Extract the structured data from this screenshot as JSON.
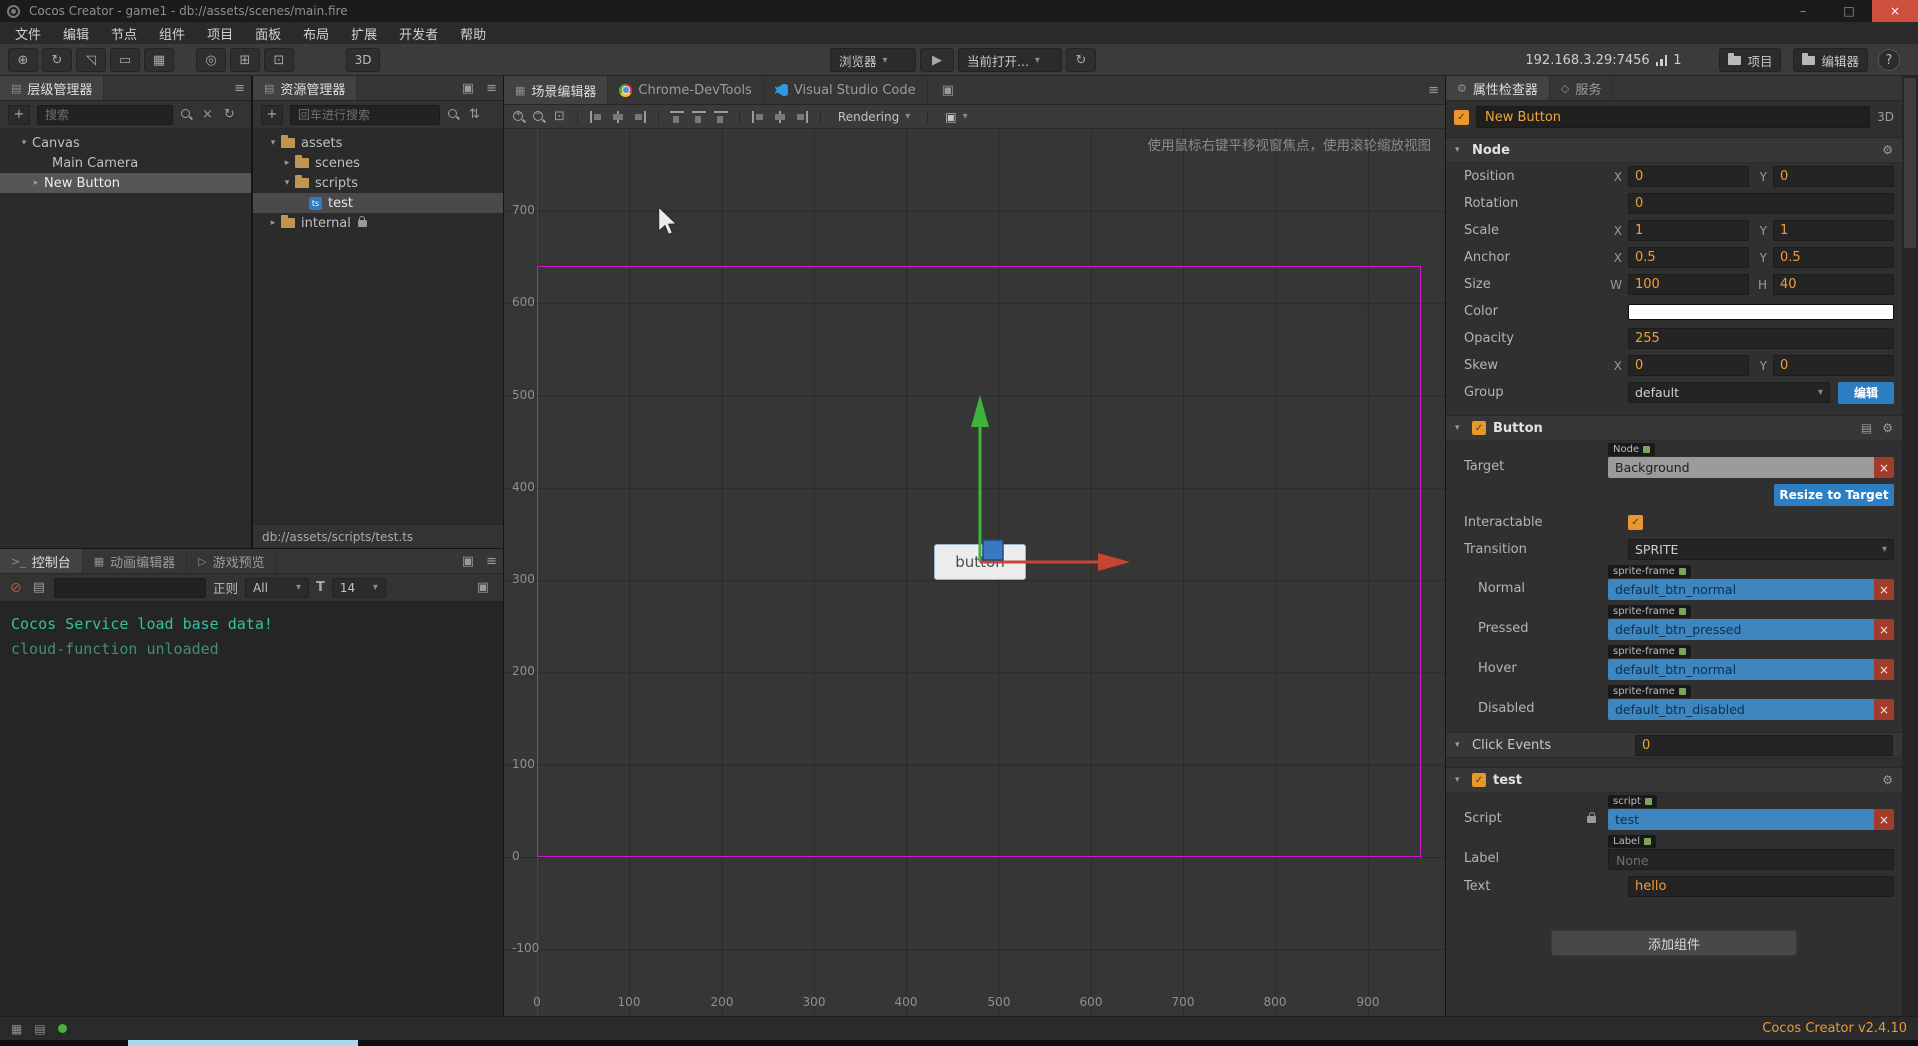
{
  "icons": {
    "menu": "≡",
    "plus": "+",
    "clear_x": "×",
    "refresh": "↻",
    "dropdown": "▾",
    "tree_expanded": "▾",
    "tree_collapsed": "▸",
    "play": "▶",
    "minimize": "–",
    "maximize": "□",
    "close": "×",
    "gear": "⚙",
    "doc": "▤",
    "help": "?",
    "check": "✓",
    "grid": "▦",
    "list": "▤",
    "terminal": ">_",
    "film": "▦",
    "gamepad": "▷",
    "services": "◇",
    "panel": "▣",
    "camera": "▣",
    "sort": "⇅",
    "zoom_plus": "+",
    "zoom_minus": "−",
    "zoom_box": "⊡",
    "move_tool": "⊕",
    "rotate_tool": "↻",
    "scale_tool": "◹",
    "rect_tool": "▭",
    "multi_tool": "▦",
    "pivot_tool": "◎",
    "local_tool": "⊞",
    "snap_tool": "⊡",
    "ts": "ts"
  },
  "titlebar": {
    "title": "Cocos Creator - game1 - db://assets/scenes/main.fire"
  },
  "menubar": {
    "items": [
      "文件",
      "编辑",
      "节点",
      "组件",
      "项目",
      "面板",
      "布局",
      "扩展",
      "开发者",
      "帮助"
    ]
  },
  "toolbar": {
    "mode3d": "3D",
    "preview_target": "浏览器",
    "current_open": "当前打开...",
    "address": "192.168.3.29:7456",
    "device_count": "1",
    "project": "项目",
    "editor": "编辑器"
  },
  "hierarchy": {
    "title": "层级管理器",
    "search_placeholder": "搜索",
    "nodes": [
      {
        "label": "Canvas"
      },
      {
        "label": "Main Camera"
      },
      {
        "label": "New Button"
      }
    ]
  },
  "assets": {
    "title": "资源管理器",
    "search_placeholder": "回车进行搜索",
    "items": [
      {
        "label": "assets"
      },
      {
        "label": "scenes"
      },
      {
        "label": "scripts"
      },
      {
        "label": "test"
      },
      {
        "label": "internal"
      }
    ],
    "status_path": "db://assets/scripts/test.ts"
  },
  "scene": {
    "tabs": [
      {
        "label": "场景编辑器"
      },
      {
        "label": "Chrome-DevTools"
      },
      {
        "label": "Visual Studio Code"
      }
    ],
    "rendering": "Rendering",
    "hint": "使用鼠标右键平移视窗焦点，使用滚轮缩放视图",
    "button_label": "button",
    "ruler_y": [
      "700",
      "600",
      "500",
      "400",
      "300",
      "200",
      "100",
      "0",
      "-100"
    ],
    "ruler_x": [
      "0",
      "100",
      "200",
      "300",
      "400",
      "500",
      "600",
      "700",
      "800",
      "900"
    ]
  },
  "console": {
    "tabs": [
      {
        "label": "控制台"
      },
      {
        "label": "动画编辑器"
      },
      {
        "label": "游戏预览"
      }
    ],
    "regex_label": "正则",
    "filter_value": "All",
    "font_label": "T",
    "fontsize_value": "14",
    "lines": [
      {
        "text": "Cocos Service load base data!"
      },
      {
        "text": "cloud-function unloaded"
      }
    ]
  },
  "inspector": {
    "tabs": [
      {
        "label": "属性检查器"
      },
      {
        "label": "服务"
      }
    ],
    "node_name": "New Button",
    "mode": "3D",
    "node": {
      "title": "Node",
      "position_label": "Position",
      "position_x": "0",
      "position_y": "0",
      "rotation_label": "Rotation",
      "rotation": "0",
      "scale_label": "Scale",
      "scale_x": "1",
      "scale_y": "1",
      "anchor_label": "Anchor",
      "anchor_x": "0.5",
      "anchor_y": "0.5",
      "size_label": "Size",
      "size_w": "100",
      "size_h": "40",
      "color_label": "Color",
      "opacity_label": "Opacity",
      "opacity": "255",
      "skew_label": "Skew",
      "skew_x": "0",
      "skew_y": "0",
      "group_label": "Group",
      "group_value": "default",
      "group_edit": "编辑"
    },
    "button": {
      "title": "Button",
      "target_label": "Target",
      "target_badge": "Node",
      "target_value": "Background",
      "resize_button": "Resize to Target",
      "interactable_label": "Interactable",
      "transition_label": "Transition",
      "transition_value": "SPRITE",
      "states": [
        {
          "label": "Normal",
          "badge": "sprite-frame",
          "value": "default_btn_normal"
        },
        {
          "label": "Pressed",
          "badge": "sprite-frame",
          "value": "default_btn_pressed"
        },
        {
          "label": "Hover",
          "badge": "sprite-frame",
          "value": "default_btn_normal"
        },
        {
          "label": "Disabled",
          "badge": "sprite-frame",
          "value": "default_btn_disabled"
        }
      ]
    },
    "click_events": {
      "title": "Click Events",
      "count": "0"
    },
    "test": {
      "title": "test",
      "script_label": "Script",
      "script_badge": "script",
      "script_value": "test",
      "label_label": "Label",
      "label_badge": "Label",
      "label_value": "None",
      "text_label": "Text",
      "text_value": "hello"
    },
    "add_component": "添加组件"
  },
  "labels": {
    "x": "X",
    "y": "Y",
    "w": "W",
    "h": "H"
  },
  "statusbar": {
    "version": "Cocos Creator v2.4.10"
  }
}
